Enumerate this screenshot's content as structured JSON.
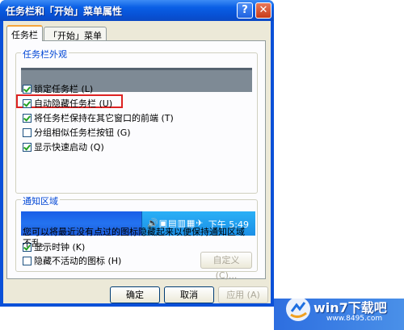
{
  "window": {
    "title": "任务栏和「开始」菜单属性",
    "help_glyph": "?",
    "close_glyph": "✕"
  },
  "tabs": [
    {
      "label": "任务栏",
      "active": true
    },
    {
      "label": "「开始」菜单",
      "active": false
    }
  ],
  "appearance": {
    "title": "任务栏外观",
    "options": [
      {
        "label": "锁定任务栏 (L)",
        "checked": true
      },
      {
        "label": "自动隐藏任务栏 (U)",
        "checked": true
      },
      {
        "label": "将任务栏保持在其它窗口的前端 (T)",
        "checked": true
      },
      {
        "label": "分组相似任务栏按钮 (G)",
        "checked": false
      },
      {
        "label": "显示快速启动 (Q)",
        "checked": true
      }
    ]
  },
  "notification": {
    "title": "通知区域",
    "tray_icons": "🔊▣▤▥▦✈",
    "tray_time": "下午 5:49",
    "show_clock": {
      "label": "显示时钟 (K)",
      "checked": true
    },
    "note": "您可以将最近没有点过的图标隐藏起来以便保持通知区域不乱。",
    "hide_inactive": {
      "label": "隐藏不活动的图标 (H)",
      "checked": false
    },
    "customize_label": "自定义 (C)..."
  },
  "buttons": {
    "ok": "确定",
    "cancel": "取消",
    "apply": "应用 (A)"
  },
  "watermark": {
    "brand": "win7下载吧",
    "url": "www.8495.com"
  },
  "colors": {
    "title_blue": "#0a5fe6",
    "group_title": "#0046d5",
    "highlight": "#dd2222",
    "check": "#21a121"
  }
}
